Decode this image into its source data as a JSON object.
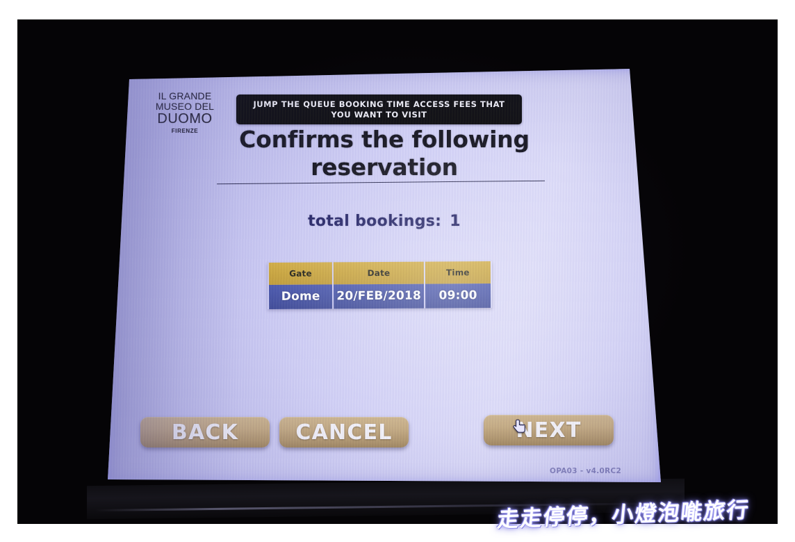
{
  "kiosk": {
    "logo": {
      "line1": "IL GRANDE",
      "line2": "MUSEO DEL",
      "line3": "DUOMO",
      "line4": "FIRENZE"
    },
    "banner": {
      "text": "JUMP THE QUEUE BOOKING TIME ACCESS FEES THAT YOU WANT TO VISIT"
    },
    "heading": {
      "line1": "Confirms the following",
      "line2": "reservation"
    },
    "summary": {
      "label": "total bookings:",
      "count": "1"
    },
    "reservation_table": {
      "columns": [
        "Gate",
        "Date",
        "Time"
      ],
      "rows": [
        {
          "gate": "Dome",
          "date": "20/FEB/2018",
          "time": "09:00"
        }
      ]
    },
    "buttons": {
      "back": "BACK",
      "cancel": "CANCEL",
      "next": "NEXT"
    },
    "version": "OPA03 - v4.0RC2",
    "cursor_icon": "pointing-hand-cursor",
    "colors": {
      "screen_bg": "#c8c7f2",
      "table_header_bg": "#c69f2e",
      "table_row_bg": "#39479d",
      "button_bg": "#c1a67a",
      "banner_bg": "#000000",
      "heading_text": "#0a0a14",
      "summary_text": "#14145a"
    }
  },
  "photo": {
    "watermark": "走走停停，小燈泡𠹌旅行"
  }
}
